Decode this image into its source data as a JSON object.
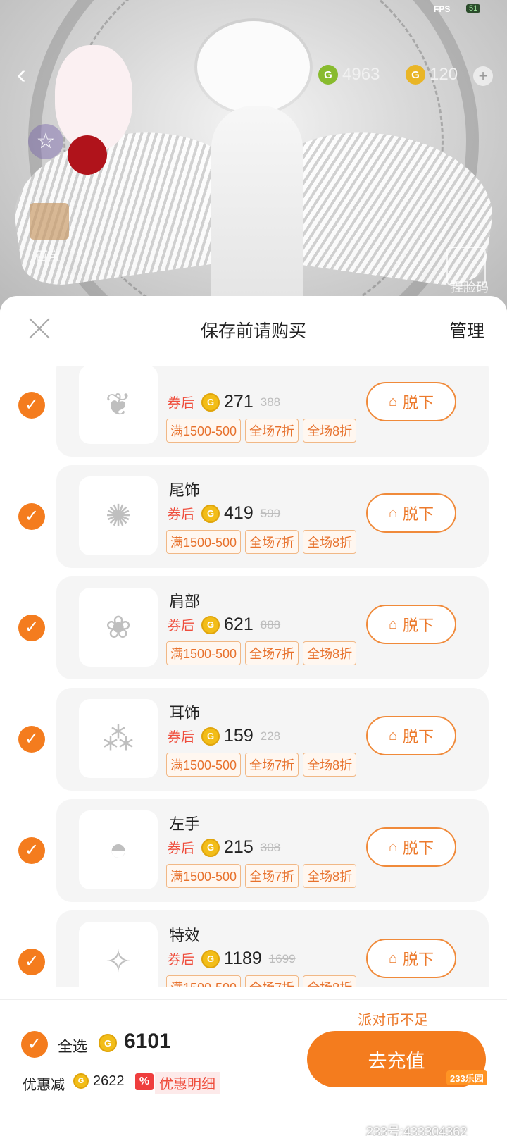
{
  "status": {
    "fps_label": "FPS",
    "fps_value": "51"
  },
  "topbar": {
    "back_icon": "chevron-left-icon",
    "green_coins": "4963",
    "yellow_coins": "120",
    "green_coin_glyph": "G",
    "yellow_coin_glyph": "G",
    "add_glyph": "+"
  },
  "side": {
    "gift_label": "百宝",
    "face_code_label": "捏脸码"
  },
  "sheet": {
    "title": "保存前请购买",
    "manage": "管理"
  },
  "labels": {
    "after_coupon": "券后",
    "take_off": "脱下",
    "coin_glyph": "G",
    "check_glyph": "✓"
  },
  "items": [
    {
      "name": "",
      "price": "271",
      "original": "388",
      "tags": [
        "满1500-500",
        "全场7折",
        "全场8折"
      ],
      "thumb_icon": "butterfly-icon"
    },
    {
      "name": "尾饰",
      "price": "419",
      "original": "599",
      "tags": [
        "满1500-500",
        "全场7折",
        "全场8折"
      ],
      "thumb_icon": "peacock-tail-icon"
    },
    {
      "name": "肩部",
      "price": "621",
      "original": "888",
      "tags": [
        "满1500-500",
        "全场7折",
        "全场8折"
      ],
      "thumb_icon": "bunny-icon"
    },
    {
      "name": "耳饰",
      "price": "159",
      "original": "228",
      "tags": [
        "满1500-500",
        "全场7折",
        "全场8折"
      ],
      "thumb_icon": "earring-icon"
    },
    {
      "name": "左手",
      "price": "215",
      "original": "308",
      "tags": [
        "满1500-500",
        "全场7折",
        "全场8折"
      ],
      "thumb_icon": "handbag-icon"
    },
    {
      "name": "特效",
      "price": "1189",
      "original": "1699",
      "tags": [
        "满1500-500",
        "全场7折",
        "全场8折"
      ],
      "thumb_icon": "aura-effect-icon"
    }
  ],
  "footer": {
    "insufficient": "派对币不足",
    "select_all": "全选",
    "total": "6101",
    "discount_label": "优惠减",
    "discount": "2622",
    "percent_glyph": "%",
    "discount_detail": "优惠明细",
    "recharge": "去充值",
    "brand_badge": "233乐园"
  },
  "watermark": "233号:433304362",
  "colors": {
    "accent": "#f47c1e",
    "coupon_red": "#ef4d3c",
    "coin_yellow": "#f2bd18",
    "coin_green": "#88bb2e"
  }
}
